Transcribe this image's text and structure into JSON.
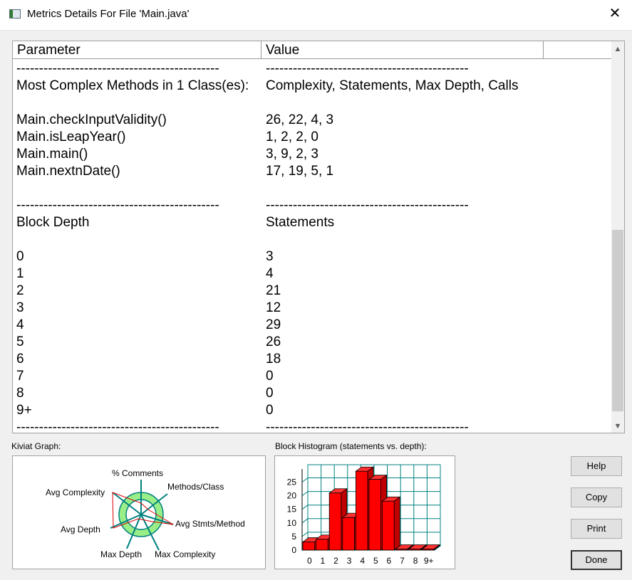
{
  "window": {
    "title": "Metrics Details For File 'Main.java'"
  },
  "table": {
    "headers": [
      "Parameter",
      "Value"
    ],
    "rows": [
      [
        "---------------------------------------------",
        "---------------------------------------------"
      ],
      [
        "Most Complex Methods in 1 Class(es):",
        "Complexity, Statements, Max Depth, Calls"
      ],
      [
        "",
        ""
      ],
      [
        "Main.checkInputValidity()",
        "26, 22, 4, 3"
      ],
      [
        "Main.isLeapYear()",
        "1, 2, 2, 0"
      ],
      [
        "Main.main()",
        "3, 9, 2, 3"
      ],
      [
        "Main.nextnDate()",
        "17, 19, 5, 1"
      ],
      [
        "",
        ""
      ],
      [
        "---------------------------------------------",
        "---------------------------------------------"
      ],
      [
        "Block Depth",
        "Statements"
      ],
      [
        "",
        ""
      ],
      [
        "0",
        "3"
      ],
      [
        "1",
        "4"
      ],
      [
        "2",
        "21"
      ],
      [
        "3",
        "12"
      ],
      [
        "4",
        "29"
      ],
      [
        "5",
        "26"
      ],
      [
        "6",
        "18"
      ],
      [
        "7",
        "0"
      ],
      [
        "8",
        "0"
      ],
      [
        "9+",
        "0"
      ],
      [
        "---------------------------------------------",
        "---------------------------------------------"
      ]
    ]
  },
  "kiviat": {
    "label": "Kiviat Graph:",
    "axes": [
      "% Comments",
      "Methods/Class",
      "Avg Stmts/Method",
      "Max Complexity",
      "Max Depth",
      "Avg Depth",
      "Avg Complexity"
    ]
  },
  "histogram": {
    "label": "Block Histogram (statements vs. depth):",
    "color": "#ff0000"
  },
  "chart_data": {
    "type": "bar",
    "categories": [
      "0",
      "1",
      "2",
      "3",
      "4",
      "5",
      "6",
      "7",
      "8",
      "9+"
    ],
    "values": [
      3,
      4,
      21,
      12,
      29,
      26,
      18,
      0,
      0,
      0
    ],
    "title": "Block Histogram (statements vs. depth):",
    "ylim": [
      0,
      25
    ],
    "yticks": [
      0,
      5,
      10,
      15,
      20,
      25
    ],
    "grid": true
  },
  "buttons": {
    "help": "Help",
    "copy": "Copy",
    "print": "Print",
    "done": "Done"
  }
}
